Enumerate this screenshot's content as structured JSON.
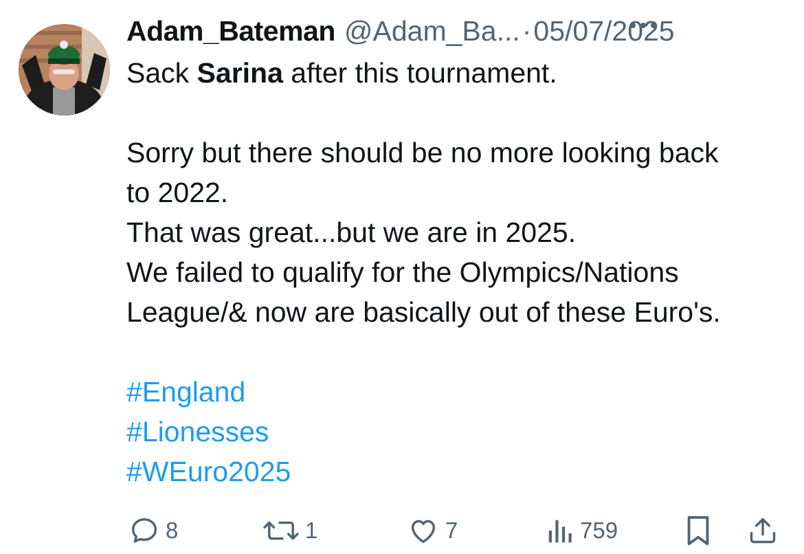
{
  "author": {
    "name": "Adam_Bateman",
    "handle": "@Adam_Ba...",
    "separator": "·",
    "date": "05/07/2025"
  },
  "tweet": {
    "line1_prefix": "Sack ",
    "line1_bold": "Sarina",
    "line1_suffix": " after this tournament.",
    "line2": "Sorry but there should be no more looking back",
    "line3": "to 2022.",
    "line4": "That was great...but we are in 2025.",
    "line5": "We failed to qualify for the Olympics/Nations",
    "line6": "League/& now are basically out of these Euro's.",
    "hashtags": [
      "#England",
      "#Lionesses",
      "#WEuro2025"
    ]
  },
  "actions": {
    "replies": "8",
    "reposts": "1",
    "likes": "7",
    "views": "759"
  },
  "icons": {
    "more": "more-icon",
    "reply": "reply-icon",
    "repost": "repost-icon",
    "like": "heart-icon",
    "views": "views-icon",
    "bookmark": "bookmark-icon",
    "share": "share-icon"
  },
  "colors": {
    "text": "#0f1419",
    "secondary": "#536471",
    "link": "#1d9bf0"
  }
}
